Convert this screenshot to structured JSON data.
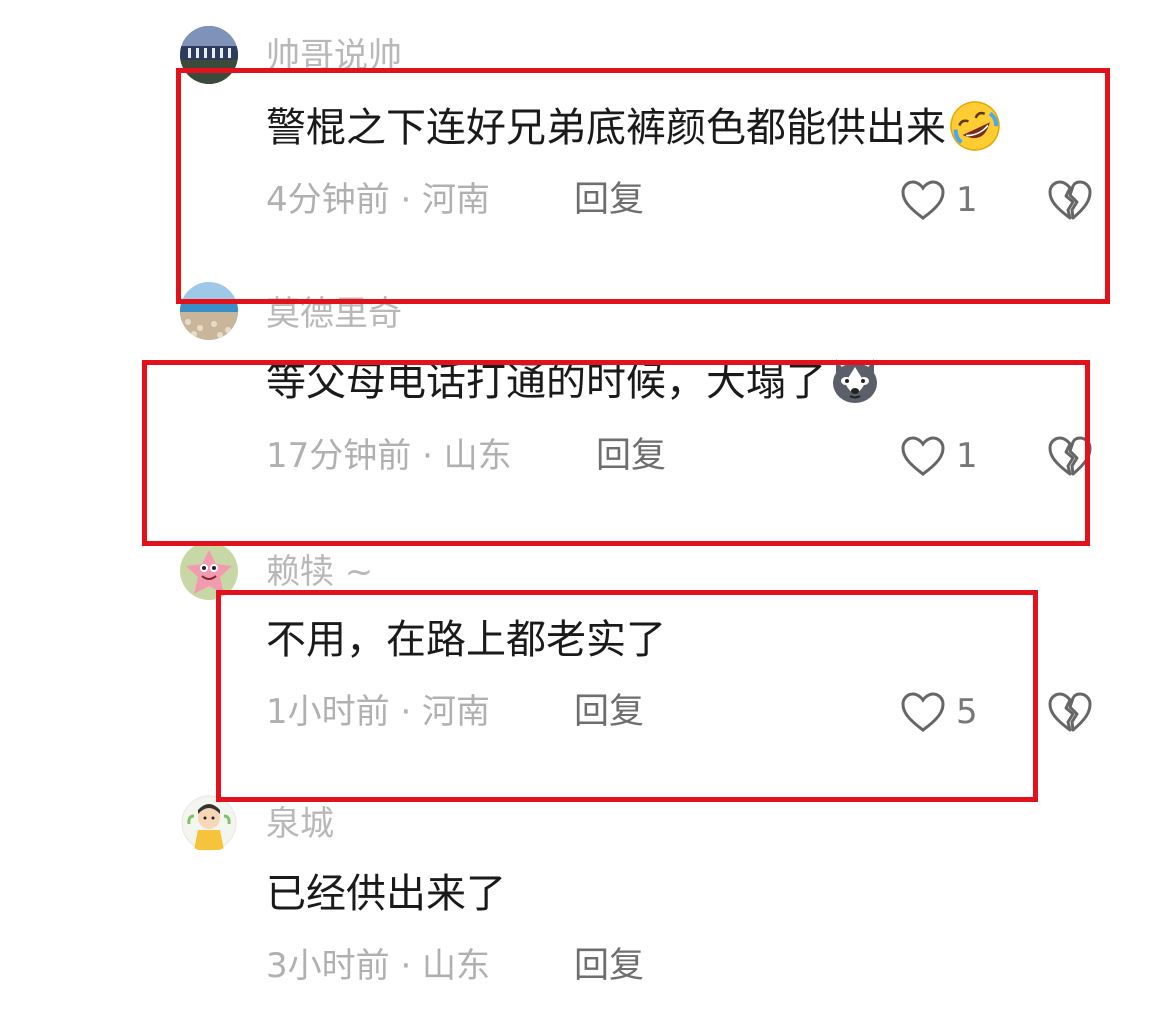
{
  "comments": [
    {
      "username": "帅哥说帅",
      "text": "警棍之下连好兄弟底裤颜色都能供出来",
      "emoji": "rofl-emoji",
      "time": "4分钟前",
      "location": "河南",
      "meta": "4分钟前 · 河南",
      "reply_label": "回复",
      "likes": "1",
      "highlighted": true
    },
    {
      "username": "莫德里奇",
      "text": "等父母电话打通的时候，大塌了",
      "emoji": "husky-dog-emoji",
      "time": "17分钟前",
      "location": "山东",
      "meta": "17分钟前 · 山东",
      "reply_label": "回复",
      "likes": "1",
      "highlighted": true
    },
    {
      "username": "赖犊 ~",
      "text": "不用，在路上都老实了",
      "emoji": "",
      "time": "1小时前",
      "location": "河南",
      "meta": "1小时前 · 河南",
      "reply_label": "回复",
      "likes": "5",
      "highlighted": true
    },
    {
      "username": "泉城",
      "text": "已经供出来了",
      "emoji": "",
      "time": "3小时前",
      "location": "山东",
      "meta": "3小时前 · 山东",
      "reply_label": "回复",
      "likes": "",
      "highlighted": false
    }
  ],
  "colors": {
    "highlight_box": "#e3111b",
    "username": "#b8b8b8",
    "meta": "#b0b0b0",
    "text": "#1a1a1a"
  },
  "icons": {
    "like": "heart-outline-icon",
    "dislike": "broken-heart-icon"
  }
}
